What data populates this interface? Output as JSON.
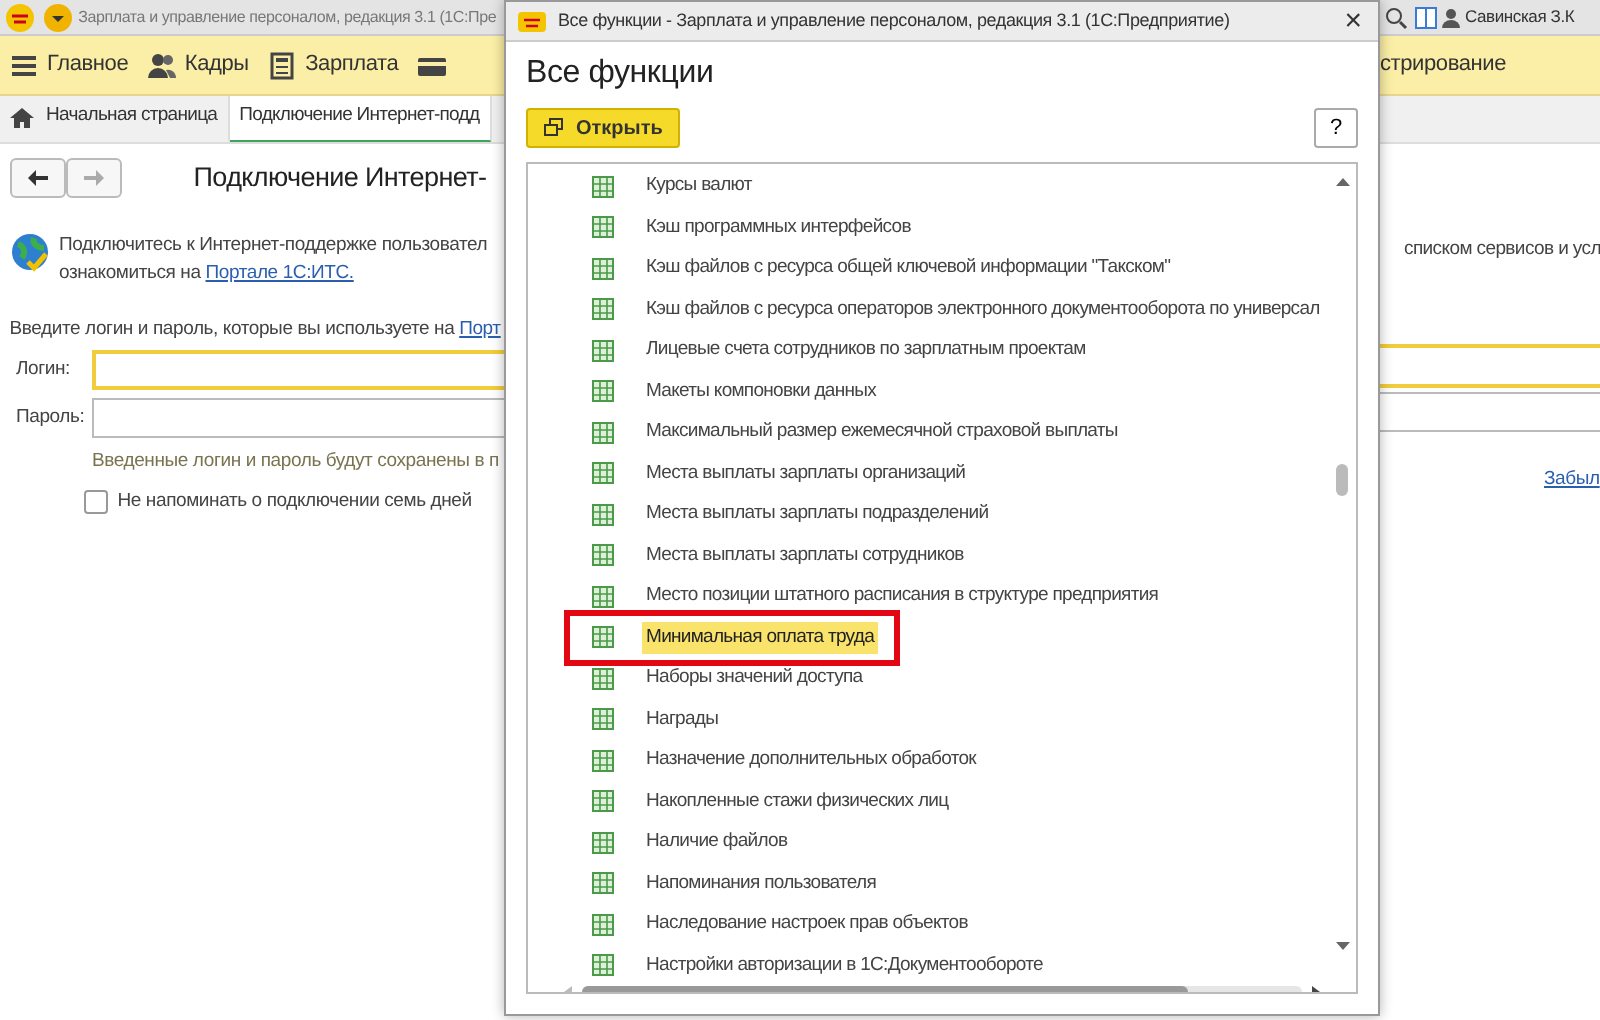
{
  "app": {
    "title": "Зарплата и управление персоналом, редакция 3.1  (1С:Пре",
    "user": "Савинская З.К",
    "sections": [
      {
        "label": "Главное"
      },
      {
        "label": "Кадры"
      },
      {
        "label": "Зарплата"
      }
    ],
    "sections_right": "стрирование",
    "tabs": [
      {
        "label": "Начальная страница",
        "selected": false
      },
      {
        "label": "Подключение Интернет-подд",
        "selected": true
      }
    ],
    "page_title": "Подключение Интернет-",
    "intro_line1": "Подключитесь к Интернет-поддержке пользовател",
    "intro_line1_right": "списком сервисов и усл",
    "intro_line2": "ознакомиться на",
    "intro_link": "Портале 1С:ИТС.",
    "prompt": "Введите логин и пароль, которые вы используете на",
    "prompt_link": "Порт",
    "login_label": "Логин:",
    "password_label": "Пароль:",
    "hint": "Введенные логин и пароль будут сохранены в п",
    "remind": {
      "label": "Не напоминать о подключении семь дней",
      "checked": false
    },
    "forgot_link": "Забыл"
  },
  "dialog": {
    "title": "Все функции - Зарплата и управление персоналом, редакция 3.1  (1С:Предприятие)",
    "close": "×",
    "heading": "Все функции",
    "open_button": "Открыть",
    "help_button": "?",
    "items": [
      {
        "label": "Курсы валют",
        "selected": false,
        "marked": false
      },
      {
        "label": "Кэш программных интерфейсов",
        "selected": false,
        "marked": false
      },
      {
        "label": "Кэш файлов с ресурса общей ключевой информации \"Такском\"",
        "selected": false,
        "marked": false
      },
      {
        "label": "Кэш файлов с ресурса операторов электронного документооборота по универсал",
        "selected": false,
        "marked": false
      },
      {
        "label": "Лицевые счета сотрудников по зарплатным проектам",
        "selected": false,
        "marked": false
      },
      {
        "label": "Макеты компоновки данных",
        "selected": false,
        "marked": false
      },
      {
        "label": "Максимальный размер ежемесячной страховой выплаты",
        "selected": false,
        "marked": false
      },
      {
        "label": "Места выплаты зарплаты организаций",
        "selected": false,
        "marked": false
      },
      {
        "label": "Места выплаты зарплаты подразделений",
        "selected": false,
        "marked": false
      },
      {
        "label": "Места выплаты зарплаты сотрудников",
        "selected": false,
        "marked": false
      },
      {
        "label": "Место позиции штатного расписания в структуре предприятия",
        "selected": false,
        "marked": false
      },
      {
        "label": "Минимальная оплата труда",
        "selected": true,
        "marked": true
      },
      {
        "label": "Наборы значений доступа",
        "selected": false,
        "marked": false
      },
      {
        "label": "Награды",
        "selected": false,
        "marked": false
      },
      {
        "label": "Назначение дополнительных обработок",
        "selected": false,
        "marked": false
      },
      {
        "label": "Накопленные стажи физических лиц",
        "selected": false,
        "marked": false
      },
      {
        "label": "Наличие файлов",
        "selected": false,
        "marked": false
      },
      {
        "label": "Напоминания пользователя",
        "selected": false,
        "marked": false
      },
      {
        "label": "Наследование настроек прав объектов",
        "selected": false,
        "marked": false
      },
      {
        "label": "Настройки авторизации в 1С:Документообороте",
        "selected": false,
        "marked": false
      }
    ]
  }
}
